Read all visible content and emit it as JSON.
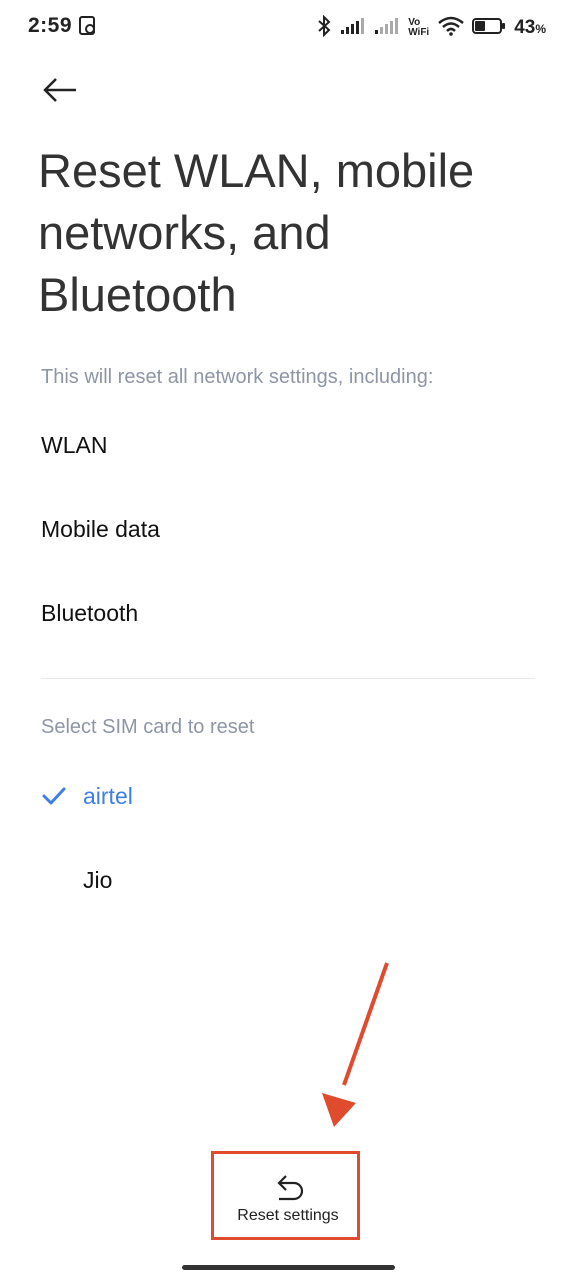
{
  "status_bar": {
    "time": "2:59",
    "vowifi_top": "Vo",
    "vowifi_bottom": "WiFi",
    "battery_percent": "43",
    "battery_symbol": "%",
    "battery_level": 0.43,
    "icons": [
      "recorder-icon",
      "bluetooth-icon",
      "signal-icon",
      "signal-icon",
      "wifi-icon",
      "battery-icon"
    ]
  },
  "header": {
    "back_icon": "back-arrow-icon",
    "title": "Reset WLAN, mobile networks, and Bluetooth"
  },
  "content": {
    "description": "This will reset all network settings, including:",
    "items": [
      "WLAN",
      "Mobile data",
      "Bluetooth"
    ],
    "sim_section_label": "Select SIM card to reset",
    "sim_options": [
      {
        "label": "airtel",
        "selected": true
      },
      {
        "label": "Jio",
        "selected": false
      }
    ]
  },
  "bottom_action": {
    "icon": "undo-icon",
    "label": "Reset settings"
  },
  "colors": {
    "accent": "#3d7ee8",
    "secondary_text": "#8e96a6",
    "annotation": "#e04b2e"
  }
}
